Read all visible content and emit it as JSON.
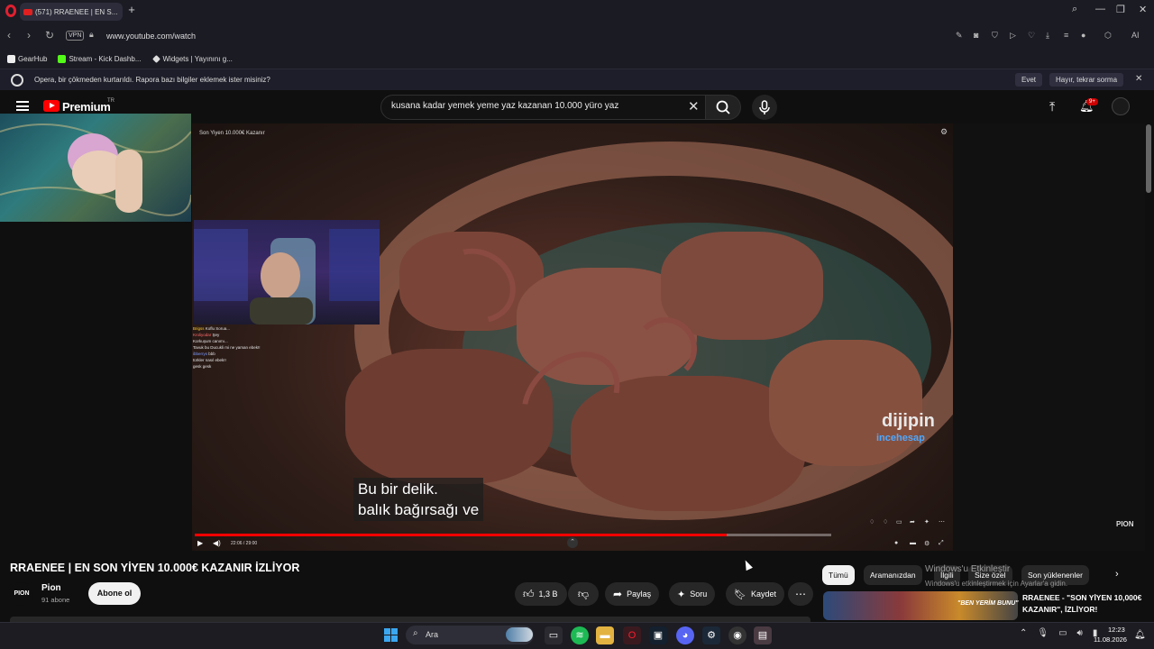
{
  "browser": {
    "tab_title": "(571) RRAENEE | EN S...",
    "url": "www.youtube.com/watch",
    "vpn_label": "VPN",
    "bookmarks": [
      {
        "label": "GearHub",
        "color": "#ffffff"
      },
      {
        "label": "Stream - Kick Dashb...",
        "color": "#53fc18"
      },
      {
        "label": "Widgets | Yayınını g...",
        "color": "#ffffff"
      }
    ],
    "infobar": {
      "text": "Opera, bir çökmeden kurtarıldı. Rapora bazı bilgiler eklemek ister misiniz?",
      "yes_label": "Evet",
      "no_label": "Hayır, tekrar sorma"
    }
  },
  "youtube": {
    "logo_text": "Premium",
    "region": "TR",
    "search_query": "kusana kadar yemek yeme yaz kazanan 10.000 yüro yaz",
    "notification_count": "9+",
    "accent_color": "#ff0000"
  },
  "player": {
    "overlay_title": "Son Yiyen 10.000€ Kazanır",
    "subtitle_line1": "Bu bir delik.",
    "subtitle_line2": "balık bağırsağı ve",
    "watermark_brand": "dijipin",
    "watermark_sub": "incehesap",
    "time_text": "22:06 / 29:00",
    "progress": 0.836,
    "corner_badge": "PION"
  },
  "stream_chat": [
    {
      "user": "",
      "msg": "",
      "color": "#ffffff"
    },
    {
      "user": "Brigss",
      "msg": "Koflu Sorua...",
      "color": "#ffcc33"
    },
    {
      "user": "Kroliyodar",
      "msg": "Şey",
      "color": "#ff6b6b"
    },
    {
      "user": "",
      "msg": "",
      "color": "#ffffff"
    },
    {
      "user": "",
      "msg": "",
      "color": "#ffffff"
    },
    {
      "user": "",
      "msg": "Korkuşum canımı...",
      "color": "#ffffff"
    },
    {
      "user": "",
      "msg": "Tavuk bu Ducukli mi ne yaman ebek!!",
      "color": "#ffcc33"
    },
    {
      "user": "ibberrys",
      "msg": "bbb",
      "color": "#7a9cff"
    },
    {
      "user": "",
      "msg": "türkler nasıl ebek!!",
      "color": "#ffffff"
    },
    {
      "user": "",
      "msg": "gesk gesk",
      "color": "#aaaaaa"
    }
  ],
  "video": {
    "title": "RRAENEE | EN SON YİYEN 10.000€ KAZANIR İZLİYOR",
    "channel_name": "Pion",
    "channel_avatar_text": "PION",
    "subscribers": "91 abone",
    "subscribe_label": "Abone ol",
    "likes": "1,3 B",
    "share_label": "Paylaş",
    "ask_label": "Soru",
    "save_label": "Kaydet"
  },
  "chips": [
    "Tümü",
    "Aramanızdan",
    "İlgili",
    "Size özel",
    "Son yüklenenler"
  ],
  "windows_watermark": {
    "line1": "Windows'u Etkinleştir",
    "line2": "Windows'u etkinleştirmek için Ayarlar'a gidin."
  },
  "recommendation": {
    "thumb_text": "\"BEN YERİM BUNU\"",
    "title": "RRAENEE - \"SON YİYEN 10,000€ KAZANIR\", İZLİYOR!"
  },
  "taskbar": {
    "search_label": "Ara",
    "time": "12:23",
    "date": "11.08.2026"
  }
}
